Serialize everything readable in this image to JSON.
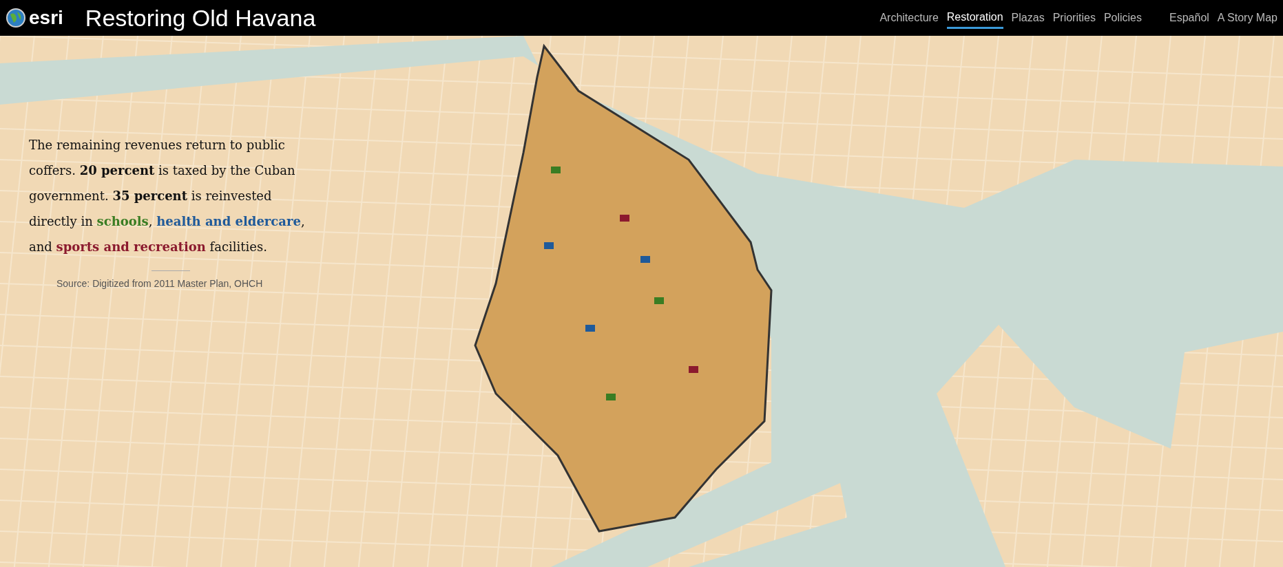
{
  "header": {
    "logo": "esri",
    "title": "Restoring Old Havana"
  },
  "nav": [
    {
      "label": "Architecture",
      "selected": false
    },
    {
      "label": "Restoration",
      "selected": true
    },
    {
      "label": "Plazas",
      "selected": false
    },
    {
      "label": "Priorities",
      "selected": false
    },
    {
      "label": "Policies",
      "selected": false
    }
  ],
  "extra_links": [
    "Español",
    "A Story Map"
  ],
  "story": {
    "paragraph": [
      {
        "kind": "plain",
        "text": "The remaining revenues return to public coffers. "
      },
      {
        "kind": "bold",
        "text": "20 percent"
      },
      {
        "kind": "plain",
        "text": " is taxed by the Cuban government. "
      },
      {
        "kind": "bold",
        "text": "35 percent"
      },
      {
        "kind": "plain",
        "text": " is reinvested directly in "
      },
      {
        "kind": "legend",
        "text": "schools",
        "color": "#3a7d23"
      },
      {
        "kind": "plain",
        "text": ", "
      },
      {
        "kind": "legend",
        "text": "health and eldercare",
        "color": "#1f5a9a"
      },
      {
        "kind": "plain",
        "text": ", and "
      },
      {
        "kind": "legend",
        "text": "sports and recreation",
        "color": "#8b1a2e"
      },
      {
        "kind": "plain",
        "text": " facilities."
      }
    ],
    "source": "Source: Digitized from 2011 Master Plan, OHCH"
  }
}
